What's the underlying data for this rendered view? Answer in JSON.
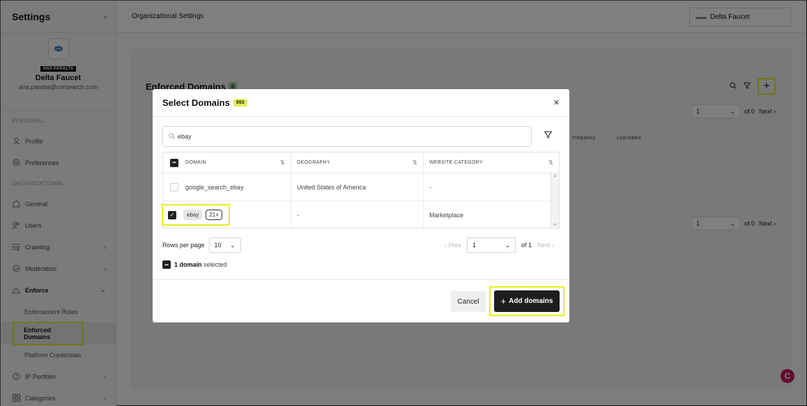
{
  "sidebar": {
    "title": "Settings",
    "collapse_icon": "collapse-icon",
    "user_chip": "ANA PARALTA",
    "org_name": "Delta Faucet",
    "email": "ana.paralta@corsearch.com",
    "personal_label": "PERSONAL",
    "organizational_label": "ORGANIZATIONAL",
    "items": [
      {
        "label": "Profile",
        "icon": "user-icon"
      },
      {
        "label": "Preferences",
        "icon": "settings-icon"
      },
      {
        "label": "General",
        "icon": "home-icon"
      },
      {
        "label": "Users",
        "icon": "users-icon"
      },
      {
        "label": "Crawling",
        "icon": "crawling-icon"
      },
      {
        "label": "Moderation",
        "icon": "shield-check-icon"
      },
      {
        "label": "Enforce",
        "icon": "enforce-icon"
      },
      {
        "label": "Enforcement Rules"
      },
      {
        "label": "Enforced Domains"
      },
      {
        "label": "Platform Credentials"
      },
      {
        "label": "IP Portfolio",
        "icon": "ip-icon"
      },
      {
        "label": "Categories",
        "icon": "grid-icon"
      }
    ]
  },
  "topbar": {
    "breadcrumb": "Organizational Settings",
    "org_select": "Delta Faucet"
  },
  "main": {
    "title": "Enforced Domains",
    "count": "0",
    "pager_top": {
      "page": "1",
      "of": "of 0",
      "next": "Next ›"
    },
    "pager_bottom": {
      "page": "1",
      "of": "of 0",
      "next": "Next ›"
    },
    "bg_col_frequency": "Frequency",
    "bg_col_last_edited": "Last edited"
  },
  "modal": {
    "title": "Select Domains",
    "count": "893",
    "search_value": "ebay",
    "columns": {
      "domain": "DOMAIN",
      "geography": "GEOGRAPHY",
      "category": "WEBSITE CATEGORY"
    },
    "rows": [
      {
        "domain": "google_search_ebay",
        "geography": "United States of America",
        "category": "-"
      },
      {
        "domain": "ebay",
        "tag": "21+",
        "geography": "-",
        "category": "Marketplace"
      }
    ],
    "rows_per_page_label": "Rows per page",
    "rows_per_page": "10",
    "prev": "‹ Prev",
    "page": "1",
    "of": "of 1",
    "next": "Next ›",
    "selected_bold": "1 domain",
    "selected_rest": "selected",
    "cancel": "Cancel",
    "add": "Add domains"
  },
  "colors": {
    "highlight": "#e8ef1e",
    "count_badge": "#e3ee52",
    "zero_badge": "#9ccfa8",
    "chat": "#c2185b"
  }
}
